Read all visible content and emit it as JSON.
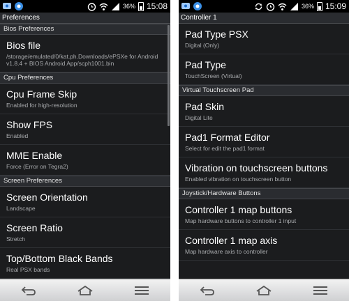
{
  "left": {
    "status": {
      "battery": "36%",
      "time": "15:08"
    },
    "title": "Preferences",
    "sections": [
      {
        "label": "Bios Preferences",
        "items": [
          {
            "title": "Bios file",
            "subtitle": "/storage/emulated/0/kat.ph.Downloads/ePSXe for Android v1.8.4 + BIOS Android App/scph1001.bin"
          }
        ]
      },
      {
        "label": "Cpu Preferences",
        "items": [
          {
            "title": "Cpu Frame Skip",
            "subtitle": "Enabled for high-resolution"
          },
          {
            "title": "Show FPS",
            "subtitle": "Enabled"
          },
          {
            "title": "MME Enable",
            "subtitle": "Force (Error on Tegra2)"
          }
        ]
      },
      {
        "label": "Screen Preferences",
        "items": [
          {
            "title": "Screen Orientation",
            "subtitle": "Landscape"
          },
          {
            "title": "Screen Ratio",
            "subtitle": "Stretch"
          },
          {
            "title": "Top/Bottom Black Bands",
            "subtitle": "Real PSX bands"
          }
        ]
      }
    ]
  },
  "right": {
    "status": {
      "battery": "36%",
      "time": "15:09"
    },
    "title": "Controller 1",
    "top_items": [
      {
        "title": "Pad Type PSX",
        "subtitle": "Digital (Only)"
      },
      {
        "title": "Pad Type",
        "subtitle": "TouchScreen (Virtual)"
      }
    ],
    "sections": [
      {
        "label": "Virtual Touchscreen Pad",
        "items": [
          {
            "title": "Pad Skin",
            "subtitle": "Digital Lite"
          },
          {
            "title": "Pad1 Format Editor",
            "subtitle": "Select for edit the pad1 format"
          },
          {
            "title": "Vibration on touchscreen buttons",
            "subtitle": "Enabled vibration on touchscreen button"
          }
        ]
      },
      {
        "label": "Joystick/Hardware Buttons",
        "items": [
          {
            "title": "Controller 1 map buttons",
            "subtitle": "Map hardware buttons to controller 1 input"
          },
          {
            "title": "Controller 1 map axis",
            "subtitle": "Map hardware axis to controller"
          }
        ]
      }
    ]
  },
  "icons": {
    "notification": "notification-icon",
    "android": "android-icon",
    "alarm": "alarm-icon",
    "sync": "sync-icon",
    "wifi": "wifi-icon",
    "signal": "signal-icon",
    "battery": "battery-icon",
    "back": "back-icon",
    "home": "home-icon",
    "menu": "menu-icon"
  },
  "colors": {
    "background": "#1b1c1e",
    "section": "#2a2c30",
    "subtitle": "#a8aaad"
  }
}
